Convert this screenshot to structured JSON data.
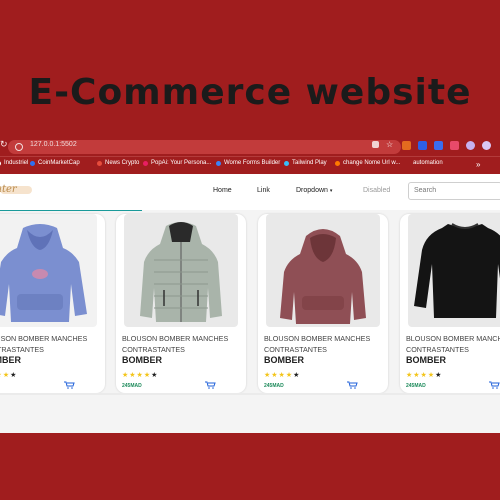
{
  "banner": {
    "title": "E-Commerce website"
  },
  "browser": {
    "url": "127.0.0.1:5502"
  },
  "bookmarks": [
    {
      "label": "Industriel",
      "color": "#ffffff"
    },
    {
      "label": "CoinMarketCap",
      "color": "#2f6ff0"
    },
    {
      "label": "News Crypto",
      "color": "#e74c3c"
    },
    {
      "label": "PopAi: Your Persona...",
      "color": "#e91e63"
    },
    {
      "label": "Wome Forms Builder",
      "color": "#3b82f6"
    },
    {
      "label": "Tailwind Play",
      "color": "#38bdf8"
    },
    {
      "label": "change Nome Url w...",
      "color": "#ff7a00"
    },
    {
      "label": "automation",
      "color": "#a01d1e"
    }
  ],
  "navbar": {
    "logo": "ater",
    "links": {
      "home": "Home",
      "link": "Link",
      "dropdown": "Dropdown",
      "disabled": "Disabled"
    },
    "search_placeholder": "Search"
  },
  "products": [
    {
      "name": "BLOUSON BOMBER MANCHES CONTRASTANTES",
      "title": "BOMBER",
      "stars": 4,
      "price": "",
      "image": "blue-hoodie-image"
    },
    {
      "name": "BLOUSON BOMBER MANCHES CONTRASTANTES",
      "title": "BOMBER",
      "stars": 4,
      "price": "245MAD",
      "image": "grey-puffer-jacket-image"
    },
    {
      "name": "BLOUSON BOMBER MANCHES CONTRASTANTES",
      "title": "BOMBER",
      "stars": 4,
      "price": "245MAD",
      "image": "maroon-hoodie-image"
    },
    {
      "name": "BLOUSON BOMBER MANCHES CONTRASTANTES",
      "title": "BOMBER",
      "stars": 4,
      "price": "245MAD",
      "image": "black-sweater-image"
    }
  ],
  "colors": {
    "background": "#a01d1e",
    "price": "#1c8a5a",
    "star": "#f3c51b",
    "accent": "#1a9a9a"
  }
}
